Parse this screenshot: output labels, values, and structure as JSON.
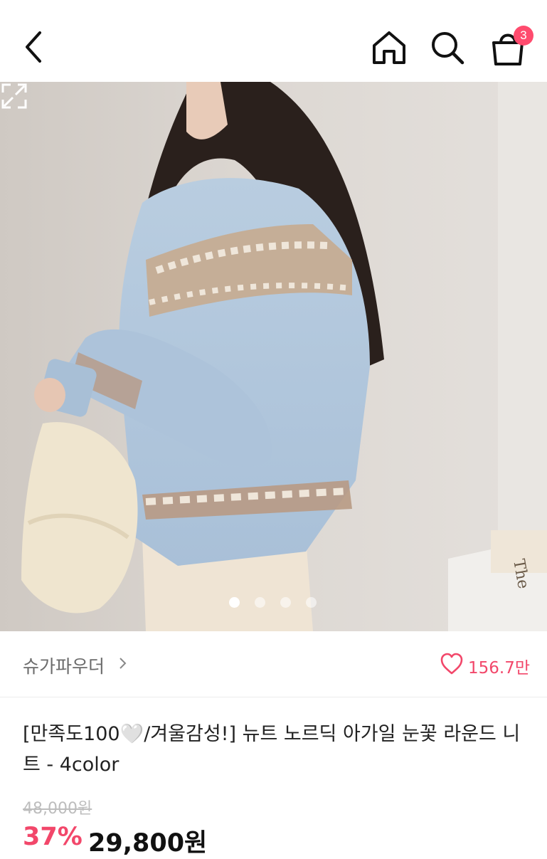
{
  "header": {
    "back_icon": "chevron-left-icon",
    "home_icon": "home-icon",
    "search_icon": "search-icon",
    "cart_icon": "shopping-bag-icon",
    "cart_count": "3",
    "badge_color": "#ff4b6e"
  },
  "gallery": {
    "image_description_icon": "product-photo",
    "page_count": 4,
    "active_index": 0,
    "expand_icon": "expand-icon"
  },
  "seller": {
    "name": "슈가파우더",
    "chevron_icon": "chevron-right-icon",
    "heart_icon": "heart-outline-icon",
    "likes": "156.7만"
  },
  "product": {
    "title": "[만족도100🤍/겨울감성!] 뉴트 노르딕 아가일 눈꽃 라운드 니트 - 4color",
    "original_price": "48,000원",
    "discount": "37%",
    "price": "29,800원",
    "accent_color": "#f2476a"
  }
}
